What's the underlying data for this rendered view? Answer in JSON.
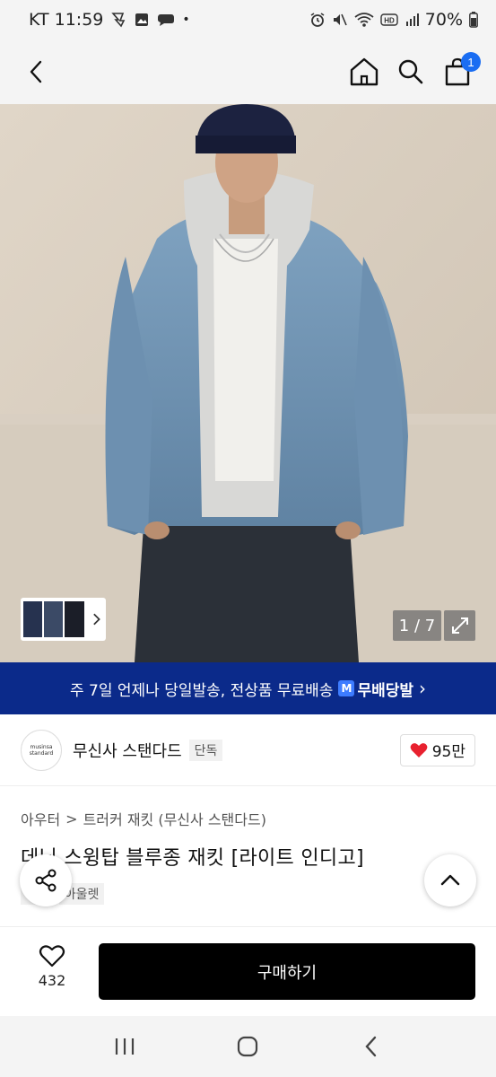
{
  "status_bar": {
    "carrier_time": "KT 11:59",
    "battery": "70%"
  },
  "header": {
    "cart_count": "1"
  },
  "hero": {
    "page_counter": "1 / 7"
  },
  "promo": {
    "text": "주 7일 언제나 당일발송, 전상품 무료배송",
    "logo_badge": "M",
    "logo_text": "무배당발",
    "arrow": "›"
  },
  "brand": {
    "logo_line1": "musinsa",
    "logo_line2": "standard",
    "name": "무신사 스탠다드",
    "tag": "단독",
    "likes": "95만"
  },
  "product": {
    "breadcrumb": [
      "아우터",
      "트러커 재킷 (무신사 스탠다드)"
    ],
    "breadcrumb_sep": ">",
    "title": "데님 스윙탑 블루종 재킷 [라이트 인디고]",
    "tags": [
      "단독",
      "아울렛"
    ]
  },
  "bottom": {
    "wish_count": "432",
    "buy_label": "구매하기"
  },
  "colors": {
    "accent_blue": "#1a6df2",
    "promo_bg": "#0b2a8a",
    "heart_red": "#e8212f"
  }
}
